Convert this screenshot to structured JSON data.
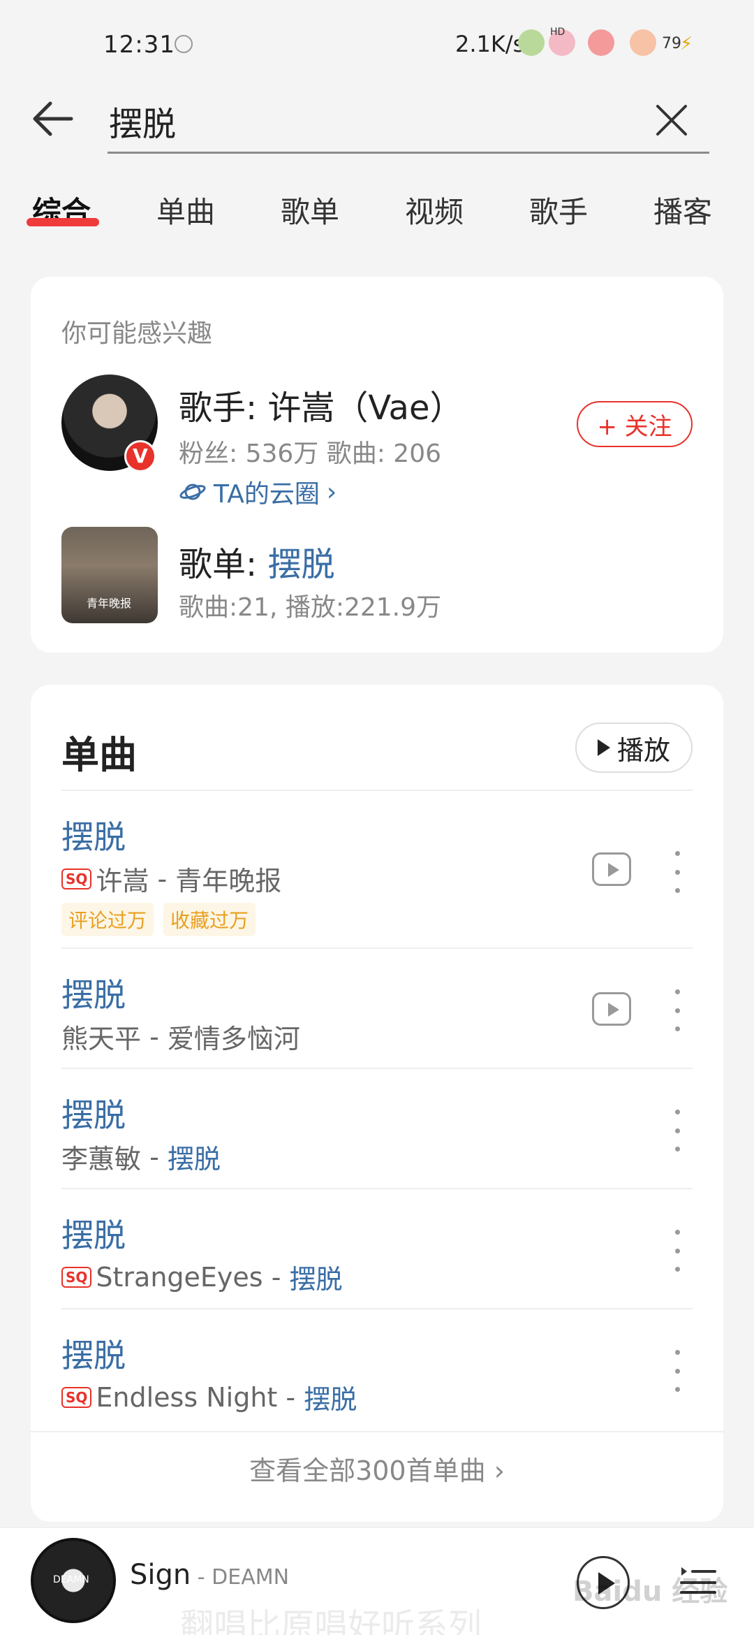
{
  "status_bar": {
    "time": "12:31",
    "speed": "2.1K/s",
    "battery": "79",
    "hd": "HD"
  },
  "search": {
    "query": "摆脱"
  },
  "tabs": [
    "综合",
    "单曲",
    "歌单",
    "视频",
    "歌手",
    "播客"
  ],
  "suggestion": {
    "section_title": "你可能感兴趣",
    "artist": {
      "name": "歌手: 许嵩（Vae）",
      "meta": "粉丝: 536万 歌曲: 206",
      "cloud_link": "TA的云圈",
      "badge": "V",
      "follow_label": "+ 关注"
    },
    "playlist": {
      "prefix": "歌单: ",
      "name": "摆脱",
      "meta": "歌曲:21, 播放:221.9万",
      "cover_text": "青年晚报"
    }
  },
  "songs": {
    "title": "单曲",
    "play_all": "播放",
    "items": [
      {
        "title": "摆脱",
        "sq": "SQ",
        "artist": "许嵩",
        "album": "青年晚报",
        "tags": [
          "评论过万",
          "收藏过万"
        ]
      },
      {
        "title": "摆脱",
        "artist": "熊天平",
        "album": "爱情多恼河"
      },
      {
        "title": "摆脱",
        "artist": "李蕙敏",
        "album": "摆脱"
      },
      {
        "title": "摆脱",
        "sq": "SQ",
        "artist": "StrangeEyes",
        "album": "摆脱"
      },
      {
        "title": "摆脱",
        "sq": "SQ",
        "artist": "Endless Night",
        "album": "摆脱"
      }
    ],
    "view_all": "查看全部300首单曲"
  },
  "player": {
    "title": "Sign",
    "separator": " - ",
    "artist": "DEAMN",
    "disc_label": "DEAMN"
  },
  "overlay": {
    "watermark": "Baidu 经验",
    "ghost": "翻唱比原唱好听系列"
  },
  "colors": {
    "accent_red": "#e8322b",
    "link_blue": "#3a6ea5",
    "tag_orange": "#e8a020"
  }
}
